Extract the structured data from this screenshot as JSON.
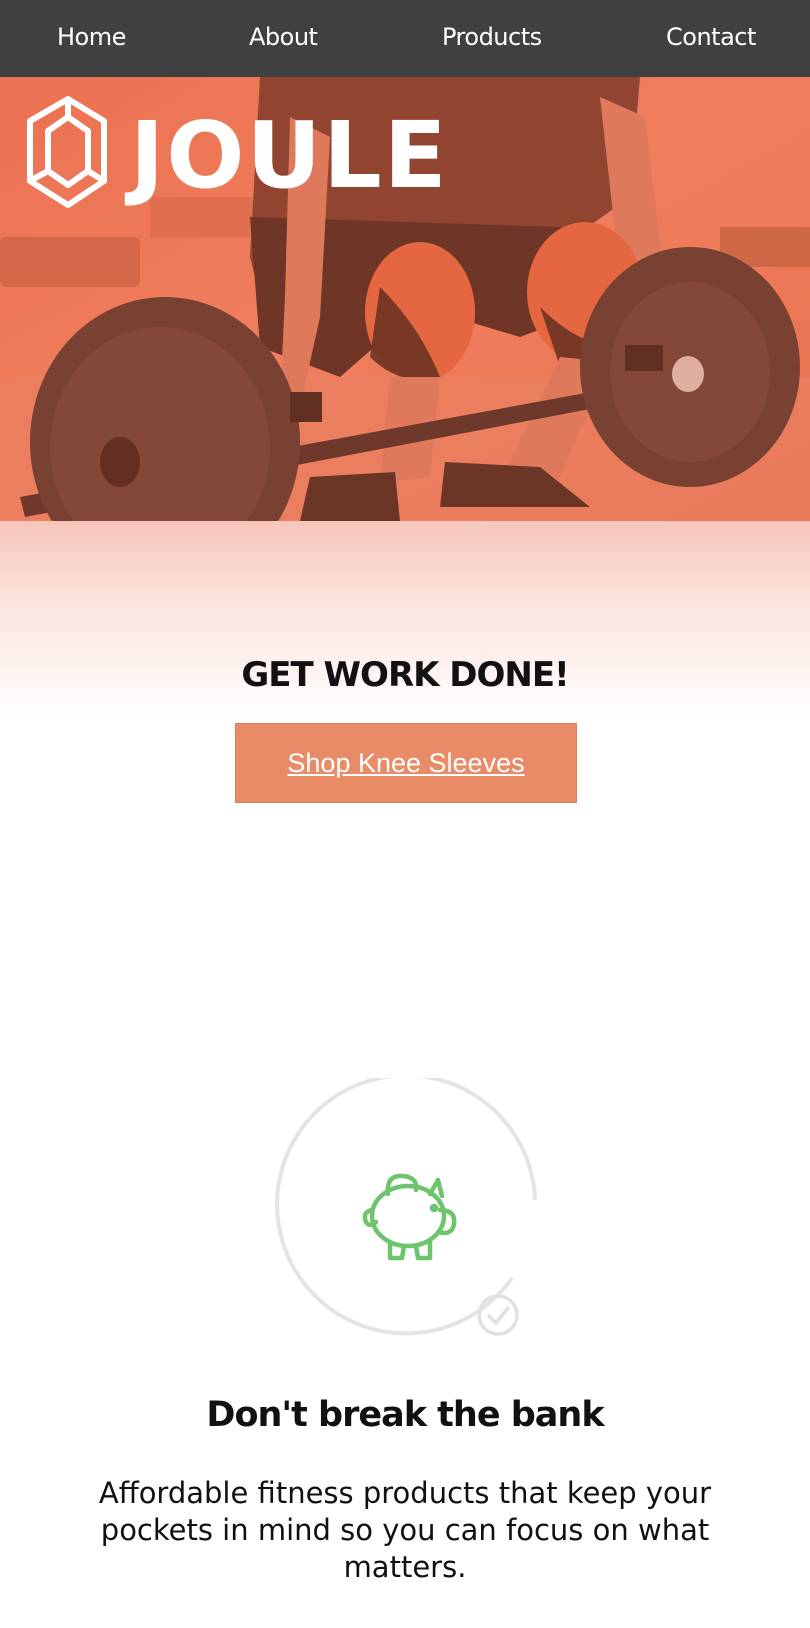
{
  "nav": {
    "items": [
      {
        "label": "Home"
      },
      {
        "label": "About"
      },
      {
        "label": "Products"
      },
      {
        "label": "Contact"
      }
    ]
  },
  "hero": {
    "logo_text": "JOULE",
    "overlay_color": "#e8643c"
  },
  "cta": {
    "title": "GET WORK DONE!",
    "button_label": "Shop Knee Sleeves",
    "button_color": "#e88b67"
  },
  "feature": {
    "icon": "piggy-bank-icon",
    "badge_icon": "check-circle-icon",
    "icon_color": "#6cc46c",
    "title": "Don't break the bank",
    "text": "Affordable fitness products that keep your pockets in mind so you can focus on what matters."
  }
}
